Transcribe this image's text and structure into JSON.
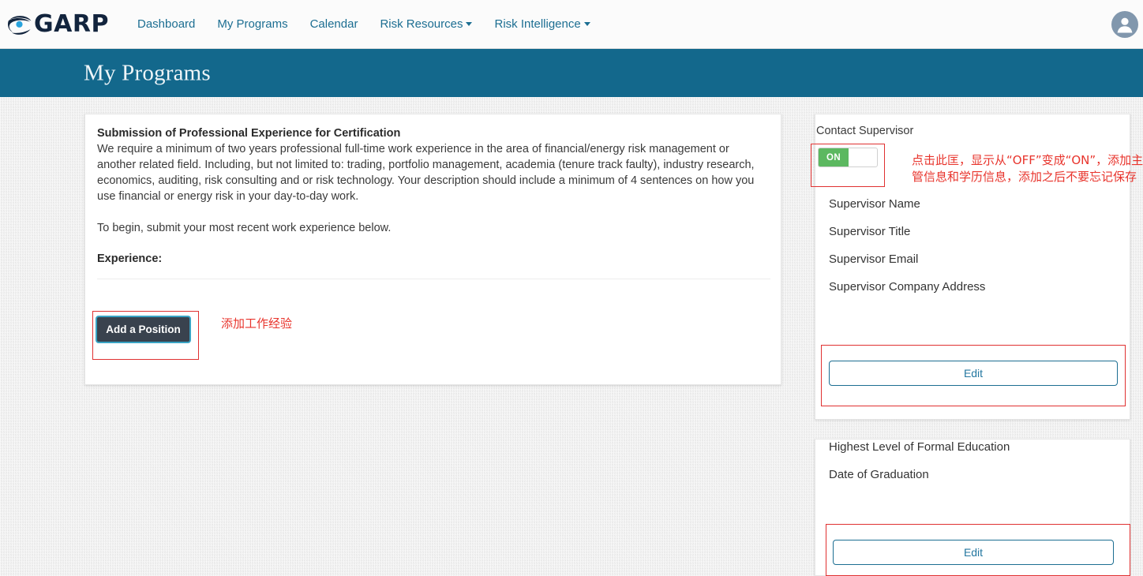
{
  "brand": {
    "wordmark": "GARP",
    "logo_icon": "garp-eye-logo",
    "logo_dark": "#12243d",
    "logo_accent": "#29a3dd"
  },
  "nav": {
    "items": [
      {
        "label": "Dashboard",
        "has_caret": false
      },
      {
        "label": "My Programs",
        "has_caret": false
      },
      {
        "label": "Calendar",
        "has_caret": false
      },
      {
        "label": "Risk Resources",
        "has_caret": true
      },
      {
        "label": "Risk Intelligence",
        "has_caret": true
      }
    ],
    "link_color": "#1c6e92",
    "avatar_icon": "user-avatar-icon"
  },
  "banner": {
    "title": "My Programs",
    "background": "#13688c"
  },
  "main_card": {
    "heading": "Submission of Professional Experience for Certification",
    "paragraph": "We require a minimum of two years professional full-time work experience in the area of financial/energy risk management or another related field. Including, but not limited to: trading, portfolio management, academia (tenure track faulty), industry research, economics, auditing, risk consulting and or risk technology. Your description should include a minimum of 4 sentences on how you use financial or energy risk in your day-to-day work.",
    "paragraph2": "To begin, submit your most recent work experience below.",
    "experience_label": "Experience:",
    "add_position_label": "Add a Position"
  },
  "annotations": {
    "color": "#e8342c",
    "add_position": "添加工作经验",
    "toggle": "点击此匡，显示从“OFF”变成“ON”，添加主管信息和学历信息，添加之后不要忘记保存"
  },
  "supervisor_card": {
    "label": "Contact Supervisor",
    "toggle_state": "ON",
    "toggle_on_color": "#5cb860",
    "fields": [
      "Supervisor Name",
      "Supervisor Title",
      "Supervisor Email",
      "Supervisor Company Address"
    ],
    "edit_label": "Edit"
  },
  "education_card": {
    "fields": [
      "Highest Level of Formal Education",
      "Date of Graduation"
    ],
    "edit_label": "Edit"
  }
}
